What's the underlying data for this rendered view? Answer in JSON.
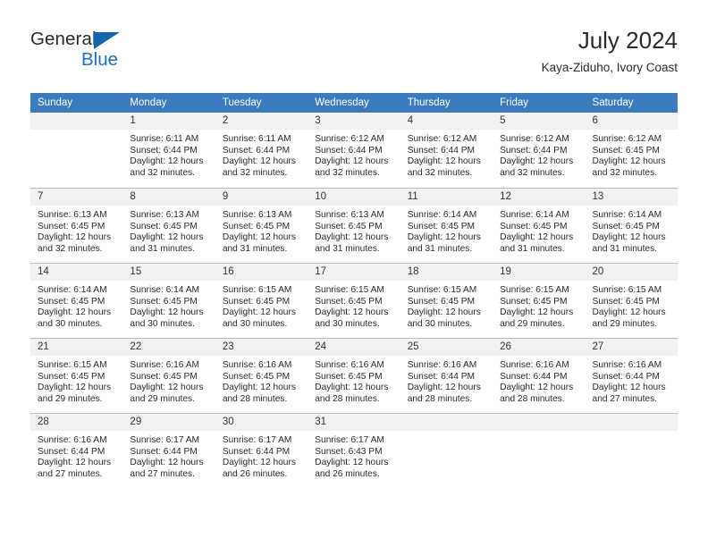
{
  "brand": {
    "word_one": "General",
    "word_two": "Blue",
    "triangle_icon": "triangle-icon",
    "colors": {
      "blue": "#1f6fc4",
      "triangle": "#1565b0"
    }
  },
  "header": {
    "title": "July 2024",
    "subtitle": "Kaya-Ziduho, Ivory Coast"
  },
  "theme": {
    "header_row_bg": "#3a7cbe",
    "day_number_bg": "#f1f1f1",
    "grid_line": "#bdbdbd",
    "text": "#2b2b2b"
  },
  "weekdays": [
    "Sunday",
    "Monday",
    "Tuesday",
    "Wednesday",
    "Thursday",
    "Friday",
    "Saturday"
  ],
  "weeks": [
    [
      {
        "day": "",
        "sunrise": "",
        "sunset": "",
        "daylight_1": "",
        "daylight_2": ""
      },
      {
        "day": "1",
        "sunrise": "Sunrise: 6:11 AM",
        "sunset": "Sunset: 6:44 PM",
        "daylight_1": "Daylight: 12 hours",
        "daylight_2": "and 32 minutes."
      },
      {
        "day": "2",
        "sunrise": "Sunrise: 6:11 AM",
        "sunset": "Sunset: 6:44 PM",
        "daylight_1": "Daylight: 12 hours",
        "daylight_2": "and 32 minutes."
      },
      {
        "day": "3",
        "sunrise": "Sunrise: 6:12 AM",
        "sunset": "Sunset: 6:44 PM",
        "daylight_1": "Daylight: 12 hours",
        "daylight_2": "and 32 minutes."
      },
      {
        "day": "4",
        "sunrise": "Sunrise: 6:12 AM",
        "sunset": "Sunset: 6:44 PM",
        "daylight_1": "Daylight: 12 hours",
        "daylight_2": "and 32 minutes."
      },
      {
        "day": "5",
        "sunrise": "Sunrise: 6:12 AM",
        "sunset": "Sunset: 6:44 PM",
        "daylight_1": "Daylight: 12 hours",
        "daylight_2": "and 32 minutes."
      },
      {
        "day": "6",
        "sunrise": "Sunrise: 6:12 AM",
        "sunset": "Sunset: 6:45 PM",
        "daylight_1": "Daylight: 12 hours",
        "daylight_2": "and 32 minutes."
      }
    ],
    [
      {
        "day": "7",
        "sunrise": "Sunrise: 6:13 AM",
        "sunset": "Sunset: 6:45 PM",
        "daylight_1": "Daylight: 12 hours",
        "daylight_2": "and 32 minutes."
      },
      {
        "day": "8",
        "sunrise": "Sunrise: 6:13 AM",
        "sunset": "Sunset: 6:45 PM",
        "daylight_1": "Daylight: 12 hours",
        "daylight_2": "and 31 minutes."
      },
      {
        "day": "9",
        "sunrise": "Sunrise: 6:13 AM",
        "sunset": "Sunset: 6:45 PM",
        "daylight_1": "Daylight: 12 hours",
        "daylight_2": "and 31 minutes."
      },
      {
        "day": "10",
        "sunrise": "Sunrise: 6:13 AM",
        "sunset": "Sunset: 6:45 PM",
        "daylight_1": "Daylight: 12 hours",
        "daylight_2": "and 31 minutes."
      },
      {
        "day": "11",
        "sunrise": "Sunrise: 6:14 AM",
        "sunset": "Sunset: 6:45 PM",
        "daylight_1": "Daylight: 12 hours",
        "daylight_2": "and 31 minutes."
      },
      {
        "day": "12",
        "sunrise": "Sunrise: 6:14 AM",
        "sunset": "Sunset: 6:45 PM",
        "daylight_1": "Daylight: 12 hours",
        "daylight_2": "and 31 minutes."
      },
      {
        "day": "13",
        "sunrise": "Sunrise: 6:14 AM",
        "sunset": "Sunset: 6:45 PM",
        "daylight_1": "Daylight: 12 hours",
        "daylight_2": "and 31 minutes."
      }
    ],
    [
      {
        "day": "14",
        "sunrise": "Sunrise: 6:14 AM",
        "sunset": "Sunset: 6:45 PM",
        "daylight_1": "Daylight: 12 hours",
        "daylight_2": "and 30 minutes."
      },
      {
        "day": "15",
        "sunrise": "Sunrise: 6:14 AM",
        "sunset": "Sunset: 6:45 PM",
        "daylight_1": "Daylight: 12 hours",
        "daylight_2": "and 30 minutes."
      },
      {
        "day": "16",
        "sunrise": "Sunrise: 6:15 AM",
        "sunset": "Sunset: 6:45 PM",
        "daylight_1": "Daylight: 12 hours",
        "daylight_2": "and 30 minutes."
      },
      {
        "day": "17",
        "sunrise": "Sunrise: 6:15 AM",
        "sunset": "Sunset: 6:45 PM",
        "daylight_1": "Daylight: 12 hours",
        "daylight_2": "and 30 minutes."
      },
      {
        "day": "18",
        "sunrise": "Sunrise: 6:15 AM",
        "sunset": "Sunset: 6:45 PM",
        "daylight_1": "Daylight: 12 hours",
        "daylight_2": "and 30 minutes."
      },
      {
        "day": "19",
        "sunrise": "Sunrise: 6:15 AM",
        "sunset": "Sunset: 6:45 PM",
        "daylight_1": "Daylight: 12 hours",
        "daylight_2": "and 29 minutes."
      },
      {
        "day": "20",
        "sunrise": "Sunrise: 6:15 AM",
        "sunset": "Sunset: 6:45 PM",
        "daylight_1": "Daylight: 12 hours",
        "daylight_2": "and 29 minutes."
      }
    ],
    [
      {
        "day": "21",
        "sunrise": "Sunrise: 6:15 AM",
        "sunset": "Sunset: 6:45 PM",
        "daylight_1": "Daylight: 12 hours",
        "daylight_2": "and 29 minutes."
      },
      {
        "day": "22",
        "sunrise": "Sunrise: 6:16 AM",
        "sunset": "Sunset: 6:45 PM",
        "daylight_1": "Daylight: 12 hours",
        "daylight_2": "and 29 minutes."
      },
      {
        "day": "23",
        "sunrise": "Sunrise: 6:16 AM",
        "sunset": "Sunset: 6:45 PM",
        "daylight_1": "Daylight: 12 hours",
        "daylight_2": "and 28 minutes."
      },
      {
        "day": "24",
        "sunrise": "Sunrise: 6:16 AM",
        "sunset": "Sunset: 6:45 PM",
        "daylight_1": "Daylight: 12 hours",
        "daylight_2": "and 28 minutes."
      },
      {
        "day": "25",
        "sunrise": "Sunrise: 6:16 AM",
        "sunset": "Sunset: 6:44 PM",
        "daylight_1": "Daylight: 12 hours",
        "daylight_2": "and 28 minutes."
      },
      {
        "day": "26",
        "sunrise": "Sunrise: 6:16 AM",
        "sunset": "Sunset: 6:44 PM",
        "daylight_1": "Daylight: 12 hours",
        "daylight_2": "and 28 minutes."
      },
      {
        "day": "27",
        "sunrise": "Sunrise: 6:16 AM",
        "sunset": "Sunset: 6:44 PM",
        "daylight_1": "Daylight: 12 hours",
        "daylight_2": "and 27 minutes."
      }
    ],
    [
      {
        "day": "28",
        "sunrise": "Sunrise: 6:16 AM",
        "sunset": "Sunset: 6:44 PM",
        "daylight_1": "Daylight: 12 hours",
        "daylight_2": "and 27 minutes."
      },
      {
        "day": "29",
        "sunrise": "Sunrise: 6:17 AM",
        "sunset": "Sunset: 6:44 PM",
        "daylight_1": "Daylight: 12 hours",
        "daylight_2": "and 27 minutes."
      },
      {
        "day": "30",
        "sunrise": "Sunrise: 6:17 AM",
        "sunset": "Sunset: 6:44 PM",
        "daylight_1": "Daylight: 12 hours",
        "daylight_2": "and 26 minutes."
      },
      {
        "day": "31",
        "sunrise": "Sunrise: 6:17 AM",
        "sunset": "Sunset: 6:43 PM",
        "daylight_1": "Daylight: 12 hours",
        "daylight_2": "and 26 minutes."
      },
      {
        "day": "",
        "sunrise": "",
        "sunset": "",
        "daylight_1": "",
        "daylight_2": ""
      },
      {
        "day": "",
        "sunrise": "",
        "sunset": "",
        "daylight_1": "",
        "daylight_2": ""
      },
      {
        "day": "",
        "sunrise": "",
        "sunset": "",
        "daylight_1": "",
        "daylight_2": ""
      }
    ]
  ]
}
